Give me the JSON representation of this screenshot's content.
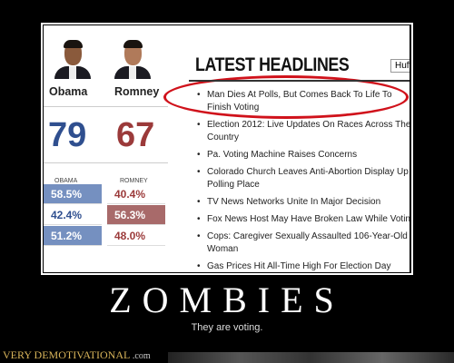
{
  "poster": {
    "title": "ZOMBIES",
    "subtitle": "They are voting.",
    "brand": "VERY DEMOTIVATIONAL",
    "brand_suffix": ".com"
  },
  "results": {
    "candidates": [
      {
        "name": "Obama",
        "votes": "79",
        "color": "#2f4f8f"
      },
      {
        "name": "Romney",
        "votes": "67",
        "color": "#9b3a3a"
      }
    ],
    "col_labels": [
      "OBAMA",
      "ROMNEY"
    ],
    "rows": [
      [
        "58.5%",
        "40.4%",
        "obama"
      ],
      [
        "42.4%",
        "56.3%",
        "romney"
      ],
      [
        "51.2%",
        "48.0%",
        "obama"
      ]
    ]
  },
  "headlines": {
    "title": "LATEST HEADLINES",
    "source": "HuffPost",
    "items": [
      [
        "Man Dies At Polls, But Comes Back To Life To",
        "Finish Voting"
      ],
      [
        "Election 2012: Live Updates On Races Across The",
        "Country"
      ],
      [
        "Pa. Voting Machine Raises Concerns"
      ],
      [
        "Colorado Church Leaves Anti-Abortion Display Up",
        "Polling Place"
      ],
      [
        "TV News Networks Unite In Major Decision"
      ],
      [
        "Fox News Host May Have Broken Law While Voting"
      ],
      [
        "Cops: Caregiver Sexually Assaulted 106-Year-Old",
        "Woman"
      ],
      [
        "Gas Prices Hit All-Time High For Election Day"
      ]
    ]
  }
}
